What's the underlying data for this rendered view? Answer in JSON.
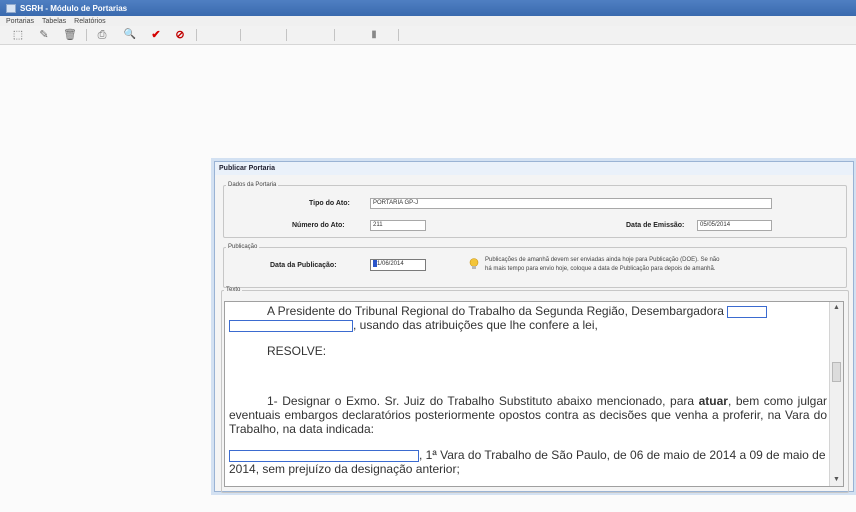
{
  "window": {
    "title": "SGRH - Módulo de Portarias"
  },
  "menu": {
    "items": [
      "Portarias",
      "Tabelas",
      "Relatórios"
    ]
  },
  "toolbar": {
    "buttons": [
      {
        "name": "new-icon",
        "glyph": "⬚"
      },
      {
        "name": "edit-icon",
        "glyph": "✎"
      },
      {
        "name": "delete-icon",
        "glyph": "🗑"
      },
      {
        "name": "print-icon",
        "glyph": "⎙"
      },
      {
        "name": "search-icon",
        "glyph": "🔍"
      },
      {
        "name": "confirm-icon",
        "glyph": "✔"
      },
      {
        "name": "cancel-icon",
        "glyph": "⊘"
      },
      {
        "name": "toggle-icon",
        "glyph": "▮"
      }
    ],
    "colors": {
      "confirm": "#d40000",
      "cancel": "#c00000"
    }
  },
  "dialog": {
    "title": "Publicar Portaria",
    "dados": {
      "legend": "Dados da Portaria",
      "tipo_label": "Tipo do Ato:",
      "tipo_value": "PORTARIA GP-J",
      "numero_label": "Número do Ato:",
      "numero_value": "211",
      "emissao_label": "Data de Emissão:",
      "emissao_value": "05/05/2014"
    },
    "publicacao": {
      "legend": "Publicação",
      "data_label": "Data da Publicação:",
      "data_value": "1/06/2014",
      "hint_line1": "Publicações de amanhã devem ser enviadas ainda hoje para Publicação (DOE). Se não",
      "hint_line2": "há mais tempo para envio hoje, coloque a data de Publicação para depois de amanhã."
    },
    "texto": {
      "legend": "Texto",
      "p1_a": "A Presidente do Tribunal Regional do Trabalho da Segunda Região, Desembargadora",
      "p1_b": ", usando das atribuições que lhe confere a lei,",
      "resolve": "RESOLVE:",
      "p2_a": "1- Designar o Exmo. Sr. Juiz do Trabalho Substituto abaixo mencionado, para ",
      "p2_bold": "atuar",
      "p2_b": ", bem como julgar eventuais embargos declaratórios posteriormente opostos contra as decisões que venha a proferir, na Vara do Trabalho, na data indicada:",
      "p3": ", 1ª Vara do Trabalho de São Paulo, de 06 de maio de 2014 a 09 de maio de 2014, sem prejuízo da designação anterior;"
    }
  }
}
